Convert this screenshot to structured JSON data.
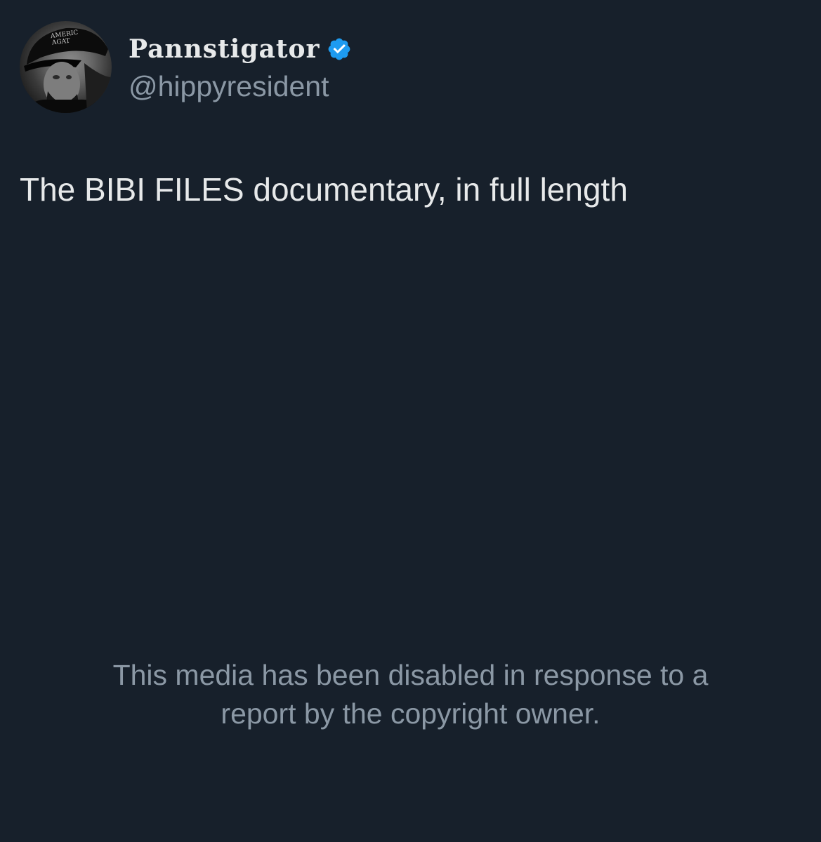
{
  "tweet": {
    "author": {
      "display_name": "Pannstigator",
      "handle": "@hippyresident",
      "verified": true,
      "avatar_icon": "profile-photo",
      "avatar_cap_text": [
        "AMERIC",
        "AGAT"
      ]
    },
    "text": "The BIBI FILES documentary, in full length",
    "media_notice": {
      "line1": "This media has been disabled in response to a",
      "line2": "report by the copyright owner."
    }
  },
  "colors": {
    "background": "#17202b",
    "primary_text": "#e7e9ea",
    "secondary_text": "#8b98a5",
    "verified_badge": "#1d9bf0"
  }
}
